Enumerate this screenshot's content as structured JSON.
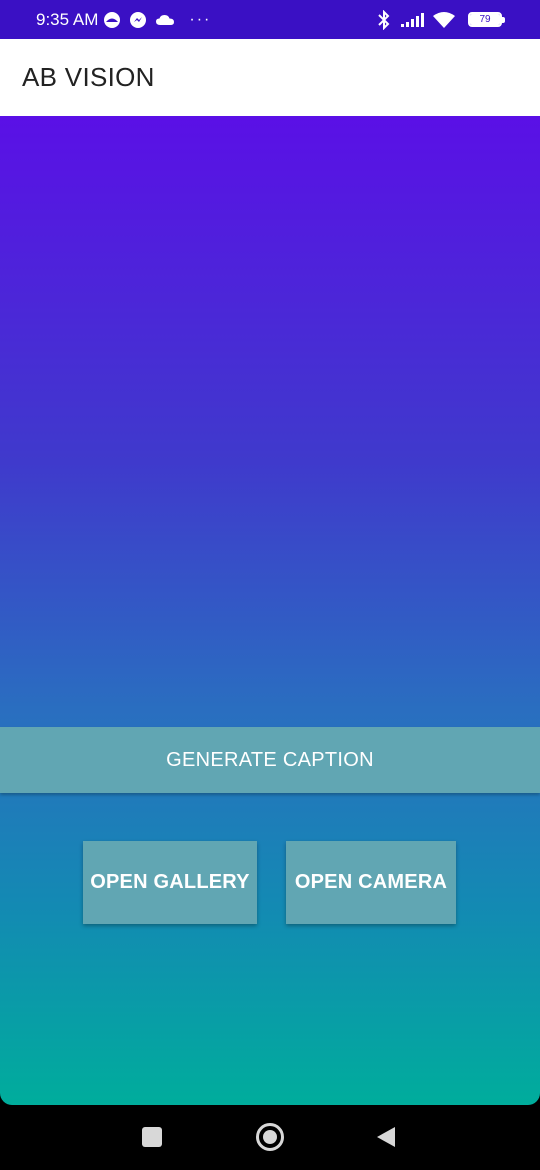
{
  "status_bar": {
    "time": "9:35 AM",
    "left_icons": [
      "circle-status-icon",
      "messenger-icon",
      "cloud-icon"
    ],
    "more": "···",
    "right_icons": [
      "bluetooth-icon",
      "signal-icon",
      "wifi-icon"
    ],
    "battery": "79"
  },
  "app_bar": {
    "title": "AB VISION"
  },
  "main": {
    "generate_label": "GENERATE CAPTION",
    "gallery_label": "OPEN GALLERY",
    "camera_label": "OPEN CAMERA"
  },
  "nav_bar": {
    "icons": [
      "recents-icon",
      "home-icon",
      "back-icon"
    ]
  },
  "colors": {
    "status_bar": "#3a10c4",
    "gradient_top": "#5a10e6",
    "gradient_bottom": "#00ad9c",
    "button": "#61a6b3"
  }
}
